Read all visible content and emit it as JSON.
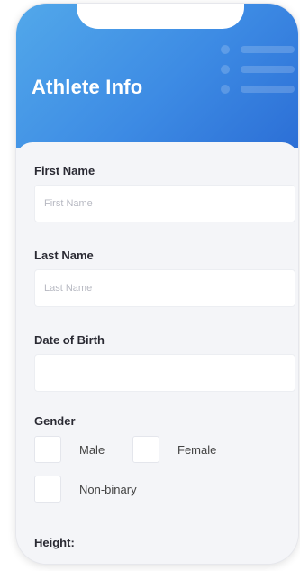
{
  "header": {
    "title": "Athlete Info"
  },
  "form": {
    "first_name": {
      "label": "First Name",
      "placeholder": "First Name",
      "value": ""
    },
    "last_name": {
      "label": "Last Name",
      "placeholder": "Last Name",
      "value": ""
    },
    "dob": {
      "label": "Date of Birth",
      "value": ""
    },
    "gender": {
      "label": "Gender",
      "options": [
        {
          "label": "Male",
          "checked": false
        },
        {
          "label": "Female",
          "checked": false
        },
        {
          "label": "Non-binary",
          "checked": false
        }
      ]
    },
    "height": {
      "label": "Height:"
    }
  },
  "colors": {
    "header_start": "#52a8ea",
    "header_end": "#2c6fd6",
    "background": "#f4f5f8"
  }
}
